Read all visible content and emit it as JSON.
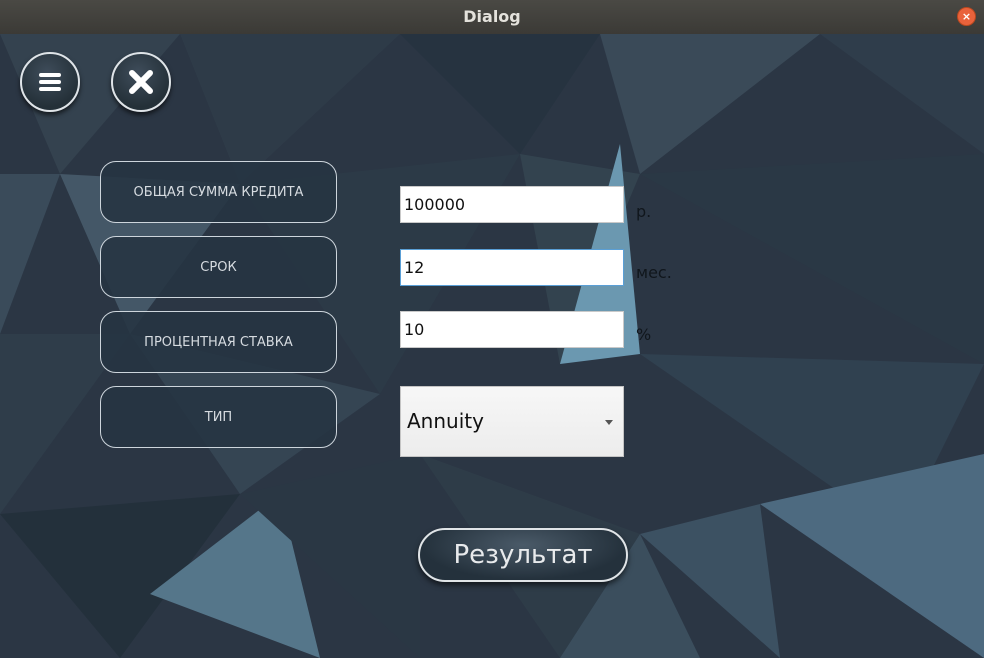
{
  "window": {
    "title": "Dialog",
    "close_glyph": "×"
  },
  "toolbar": {
    "menu_icon": "menu-icon",
    "close_icon": "close-x-icon"
  },
  "labels": {
    "total": "ОБЩАЯ СУММА КРЕДИТА",
    "term": "СРОК",
    "rate": "ПРОЦЕНТНАЯ СТАВКА",
    "type": "ТИП"
  },
  "inputs": {
    "amount": {
      "value": "100000",
      "unit": "р."
    },
    "term": {
      "value": "12",
      "unit": "мес."
    },
    "rate": {
      "value": "10",
      "unit": "%"
    }
  },
  "loan_type": {
    "selected": "Annuity"
  },
  "result_button": "Результат",
  "colors": {
    "titlebar": "#3d3c38",
    "close": "#e9623b",
    "background": "#2b3644"
  }
}
